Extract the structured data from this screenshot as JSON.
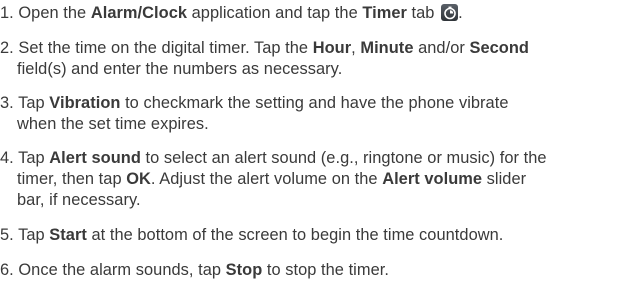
{
  "steps": [
    {
      "number": "1.",
      "lines": [
        [
          {
            "t": " Open the "
          },
          {
            "b": "Alarm/Clock"
          },
          {
            "t": " application and tap the "
          },
          {
            "b": "Timer"
          },
          {
            "t": " tab "
          },
          {
            "icon": "timer-tab-icon"
          },
          {
            "t": "."
          }
        ]
      ]
    },
    {
      "number": "2.",
      "lines": [
        [
          {
            "t": " Set the time on the digital timer. Tap the "
          },
          {
            "b": "Hour"
          },
          {
            "t": ", "
          },
          {
            "b": "Minute"
          },
          {
            "t": " and/or "
          },
          {
            "b": "Second"
          }
        ],
        [
          {
            "t": "field(s) and enter the numbers as necessary."
          }
        ]
      ]
    },
    {
      "number": "3.",
      "lines": [
        [
          {
            "t": " Tap "
          },
          {
            "b": "Vibration"
          },
          {
            "t": " to checkmark the setting and have the phone vibrate"
          }
        ],
        [
          {
            "t": "when the set time expires."
          }
        ]
      ]
    },
    {
      "number": "4.",
      "lines": [
        [
          {
            "t": " Tap "
          },
          {
            "b": "Alert sound"
          },
          {
            "t": " to select an alert sound (e.g., ringtone or music) for the"
          }
        ],
        [
          {
            "t": "timer, then tap "
          },
          {
            "b": "OK"
          },
          {
            "t": ". Adjust the alert volume on the "
          },
          {
            "b": "Alert volume"
          },
          {
            "t": " slider"
          }
        ],
        [
          {
            "t": "bar, if necessary."
          }
        ]
      ]
    },
    {
      "number": "5.",
      "lines": [
        [
          {
            "t": " Tap "
          },
          {
            "b": "Start"
          },
          {
            "t": " at the bottom of the screen to begin the time countdown."
          }
        ]
      ]
    },
    {
      "number": "6.",
      "lines": [
        [
          {
            "t": " Once the alarm sounds, tap "
          },
          {
            "b": "Stop"
          },
          {
            "t": " to stop the timer."
          }
        ]
      ]
    }
  ]
}
